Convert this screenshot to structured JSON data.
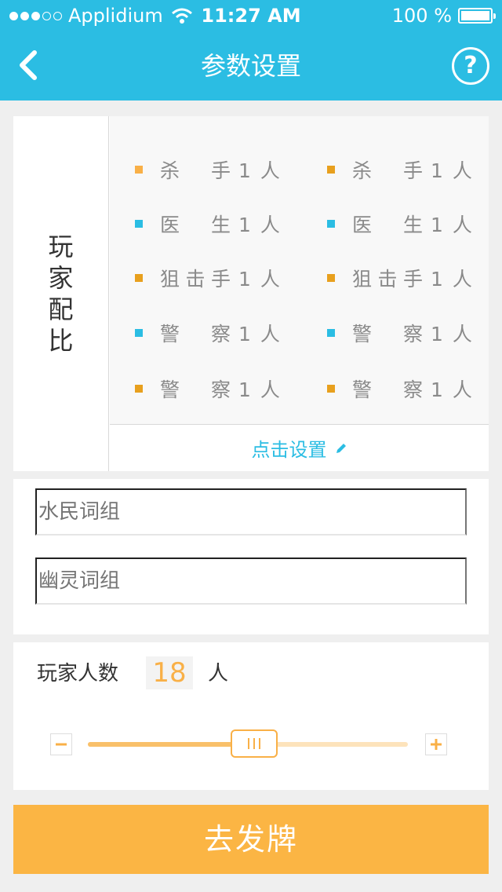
{
  "status_bar": {
    "carrier": "Applidium",
    "time": "11:27 AM",
    "battery": "100 %",
    "signal_bars": 3
  },
  "nav": {
    "title": "参数设置",
    "help_label": "?"
  },
  "roles": {
    "section_label": "玩家配比",
    "items": [
      {
        "name": "杀手",
        "count": "1 人",
        "color": "#f9b047"
      },
      {
        "name": "杀手",
        "count": "1 人",
        "color": "#e8a01e"
      },
      {
        "name": "医生",
        "count": "1 人",
        "color": "#2bbde3"
      },
      {
        "name": "医生",
        "count": "1 人",
        "color": "#2bbde3"
      },
      {
        "name": "狙击手",
        "count": "1 人",
        "color": "#e8a01e"
      },
      {
        "name": "狙击手",
        "count": "1 人",
        "color": "#e8a01e"
      },
      {
        "name": "警察",
        "count": "1 人",
        "color": "#2bbde3"
      },
      {
        "name": "警察",
        "count": "1 人",
        "color": "#2bbde3"
      },
      {
        "name": "警察",
        "count": "1 人",
        "color": "#e8a01e"
      },
      {
        "name": "警察",
        "count": "1 人",
        "color": "#e8a01e"
      }
    ],
    "setting_label": "点击设置"
  },
  "words": {
    "civilian_placeholder": "水民词组",
    "ghost_placeholder": "幽灵词组"
  },
  "player_count": {
    "label": "玩家人数",
    "value": "18",
    "unit": "人",
    "slider_fraction": 0.52,
    "minus_label": "−",
    "plus_label": "+"
  },
  "deal_button": {
    "label": "去发牌"
  },
  "colors": {
    "header": "#2bbde3",
    "accent_orange": "#fbb544",
    "accent_blue": "#2bbde3"
  }
}
